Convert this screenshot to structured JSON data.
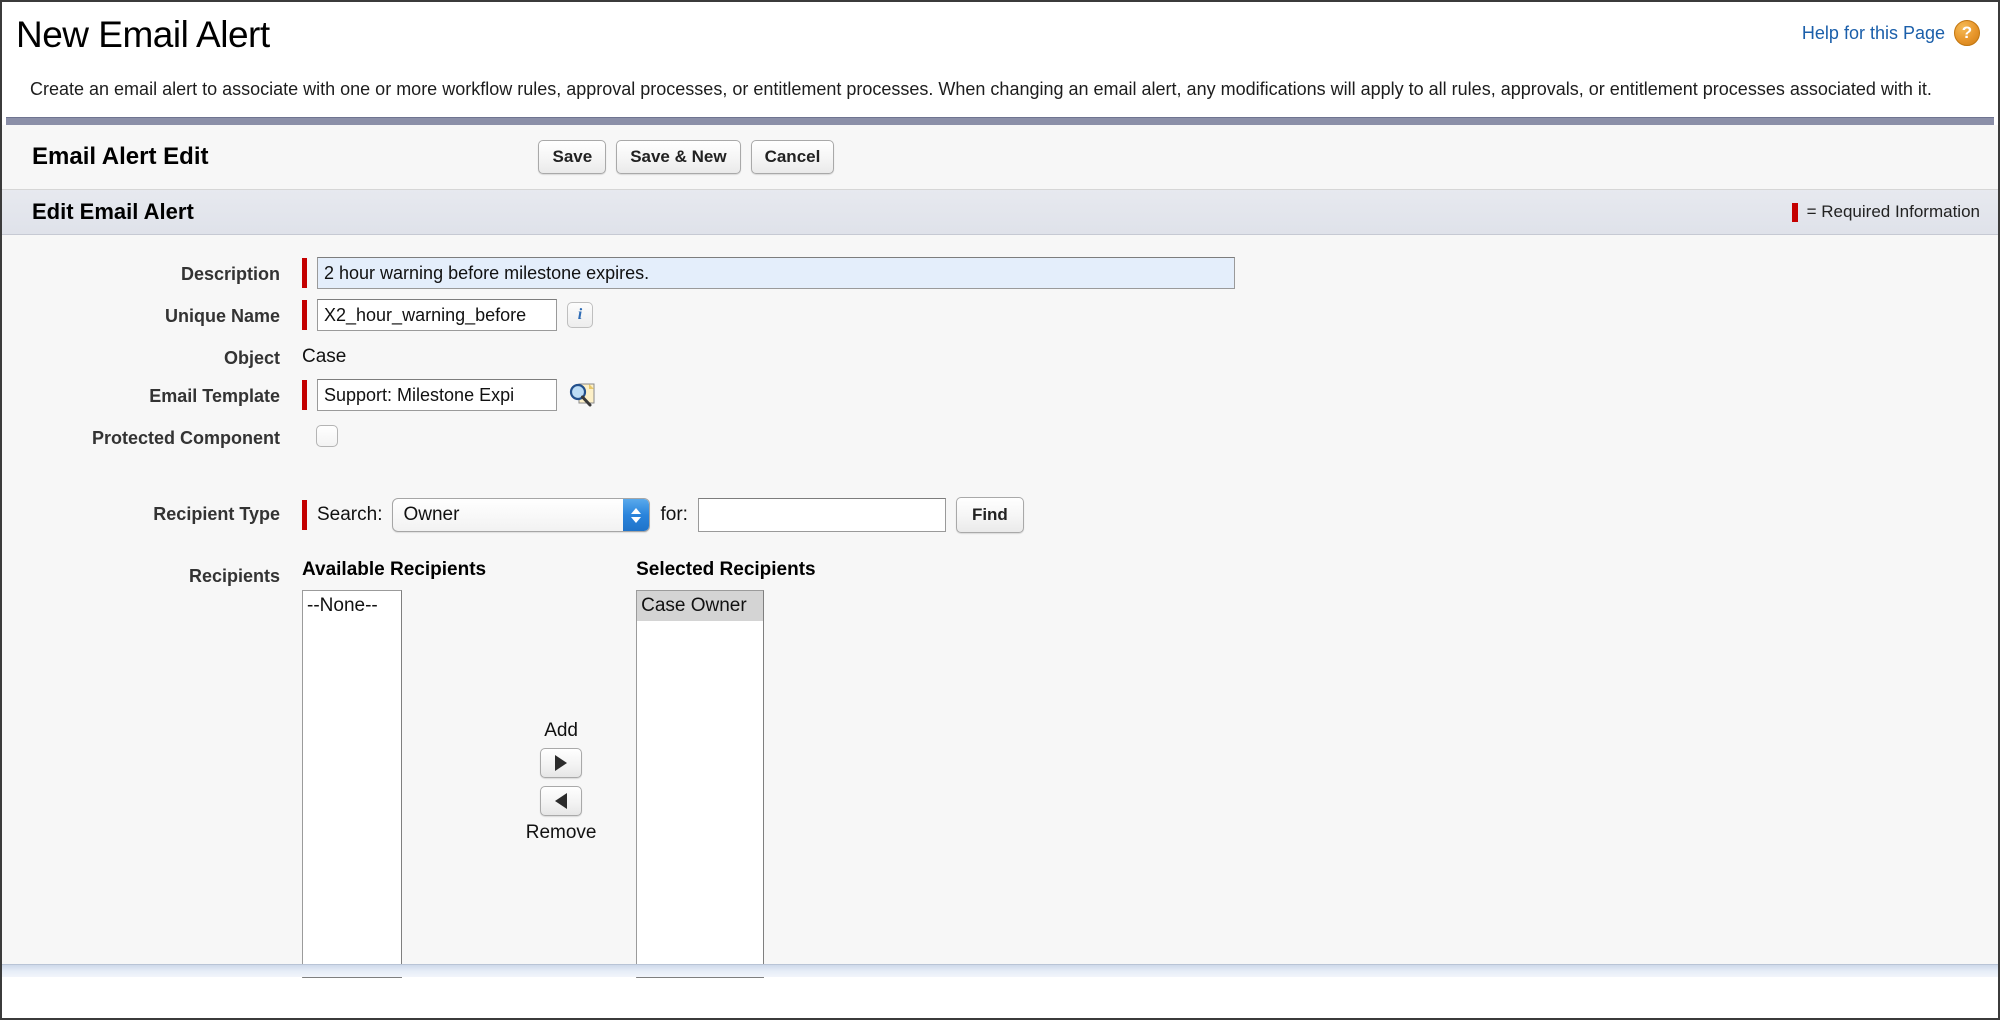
{
  "header": {
    "title": "New Email Alert",
    "help_link": "Help for this Page",
    "help_icon": "question-mark-icon",
    "description": "Create an email alert to associate with one or more workflow rules, approval processes, or entitlement processes. When changing an email alert, any modifications will apply to all rules, approvals, or entitlement processes associated with it."
  },
  "toolbar": {
    "title": "Email Alert Edit",
    "save_label": "Save",
    "save_new_label": "Save & New",
    "cancel_label": "Cancel"
  },
  "section": {
    "title": "Edit Email Alert",
    "required_legend": "= Required Information"
  },
  "fields": {
    "description": {
      "label": "Description",
      "value": "2 hour warning before milestone expires.",
      "required": true,
      "focused": true
    },
    "unique_name": {
      "label": "Unique Name",
      "value": "X2_hour_warning_before",
      "required": true,
      "info_icon": "info-icon"
    },
    "object": {
      "label": "Object",
      "value": "Case"
    },
    "email_template": {
      "label": "Email Template",
      "value": "Support: Milestone Expi",
      "required": true,
      "lookup_icon": "lookup-magnifier-icon"
    },
    "protected_component": {
      "label": "Protected Component",
      "checked": false
    },
    "recipient_type": {
      "label": "Recipient Type",
      "search_label": "Search:",
      "selected_option": "Owner",
      "for_label": "for:",
      "for_value": "",
      "find_label": "Find",
      "required": true
    },
    "recipients": {
      "label": "Recipients",
      "available_title": "Available Recipients",
      "selected_title": "Selected Recipients",
      "available_options": [
        "--None--"
      ],
      "selected_options": [
        "Case Owner"
      ],
      "selected_highlighted": "Case Owner",
      "add_label": "Add",
      "remove_label": "Remove"
    }
  },
  "colors": {
    "required_bar": "#c40000",
    "link": "#1b5faa",
    "help_icon": "#e7952a",
    "focus_field": "#e4eefb",
    "section_band": "#e1e4ec"
  }
}
